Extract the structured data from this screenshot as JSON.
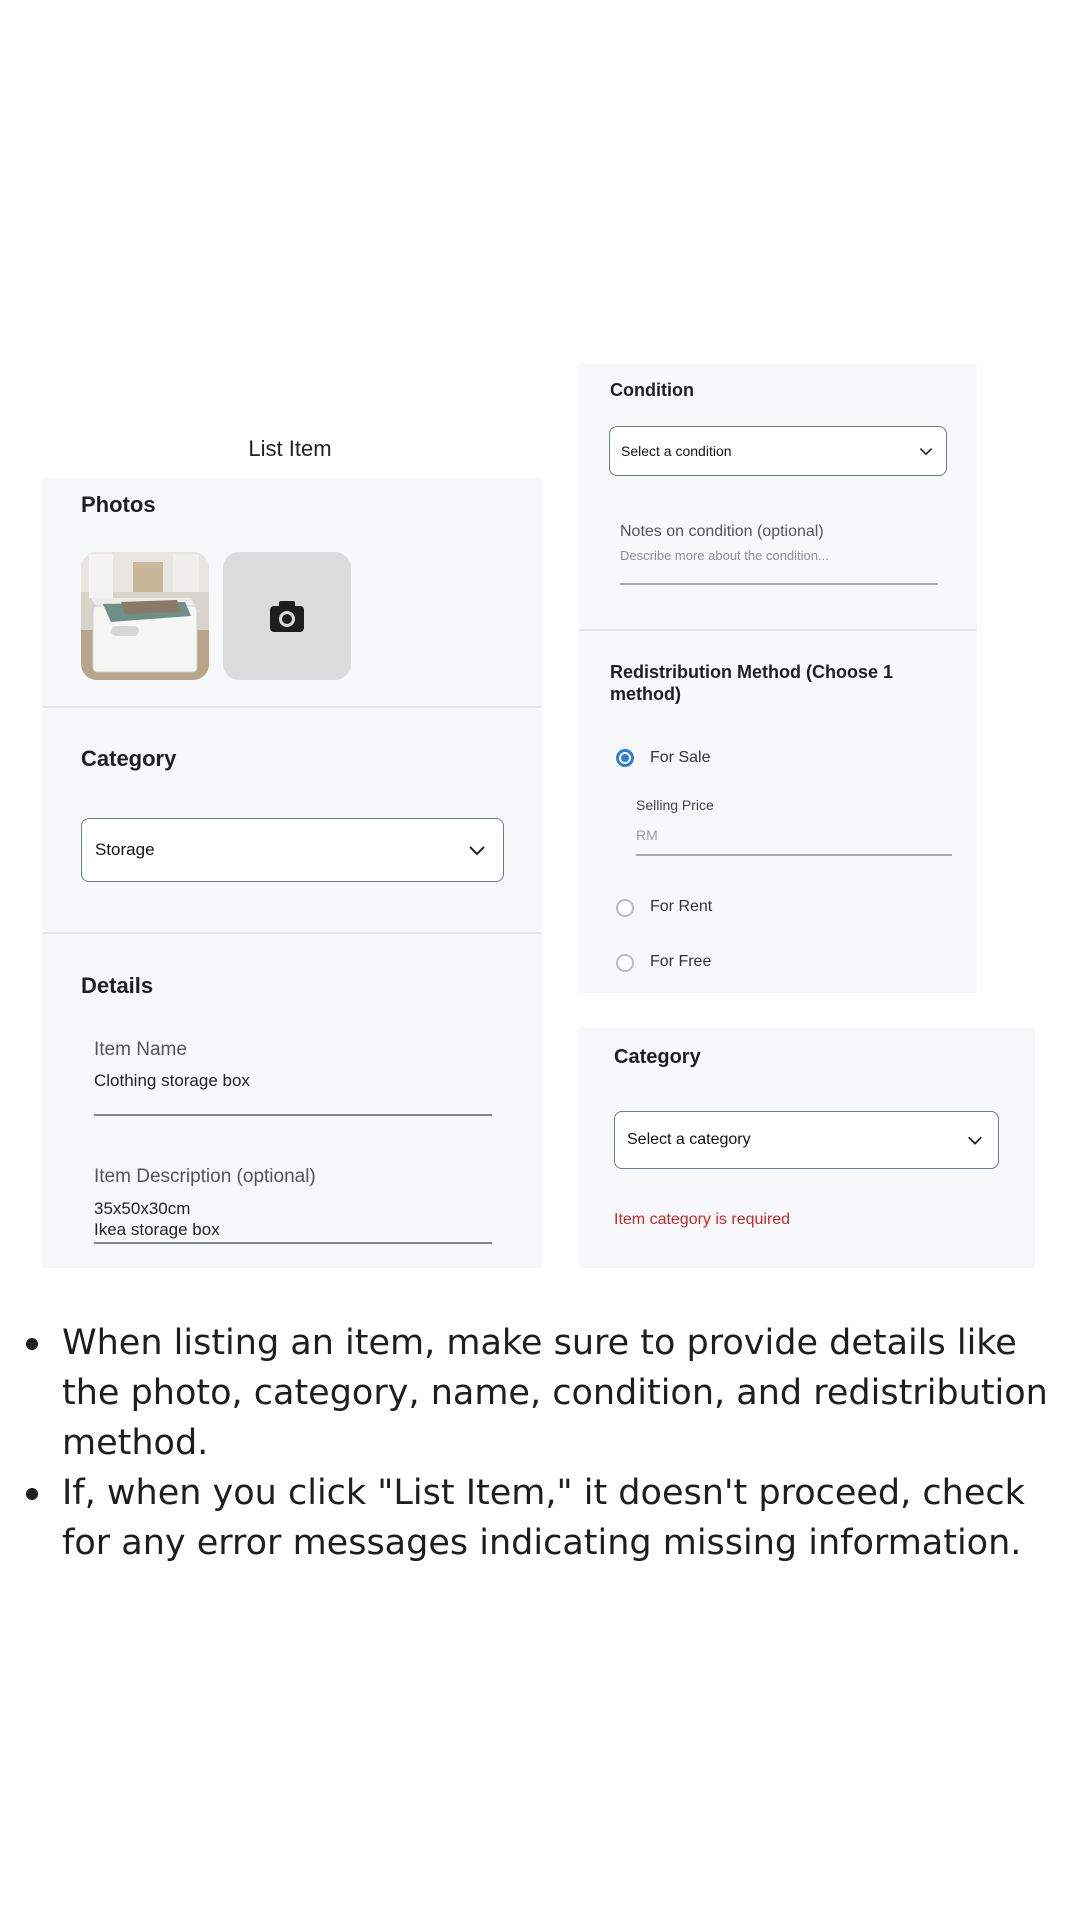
{
  "left_form": {
    "title": "List Item",
    "photos": {
      "heading": "Photos",
      "thumbnail_alt": "storage box photo",
      "add_photo_icon": "camera-icon"
    },
    "category": {
      "heading": "Category",
      "selected": "Storage"
    },
    "details": {
      "heading": "Details",
      "item_name_label": "Item Name",
      "item_name_value": "Clothing storage box",
      "item_description_label": "Item Description (optional)",
      "item_description_line1": "35x50x30cm",
      "item_description_line2": "Ikea storage box"
    }
  },
  "right_form": {
    "condition": {
      "heading": "Condition",
      "select_placeholder": "Select a condition",
      "notes_label": "Notes on condition (optional)",
      "notes_placeholder": "Describe more about the condition..."
    },
    "redistribution": {
      "heading": "Redistribution Method (Choose 1 method)",
      "options": [
        {
          "label": "For Sale",
          "checked": true
        },
        {
          "label": "For Rent",
          "checked": false
        },
        {
          "label": "For Free",
          "checked": false
        }
      ],
      "selling_price_label": "Selling Price",
      "selling_price_placeholder": "RM"
    },
    "category": {
      "heading": "Category",
      "select_placeholder": "Select a category",
      "error": "Item category is required"
    }
  },
  "instructions": [
    "When listing an item, make sure to provide details like the photo, category, name, condition, and redistribution method.",
    "If, when you click \"List Item,\" it doesn't proceed, check for any error messages indicating missing information."
  ],
  "colors": {
    "panel": "#f7f8fa",
    "accent": "#2e7fd0",
    "error": "#c62828"
  }
}
